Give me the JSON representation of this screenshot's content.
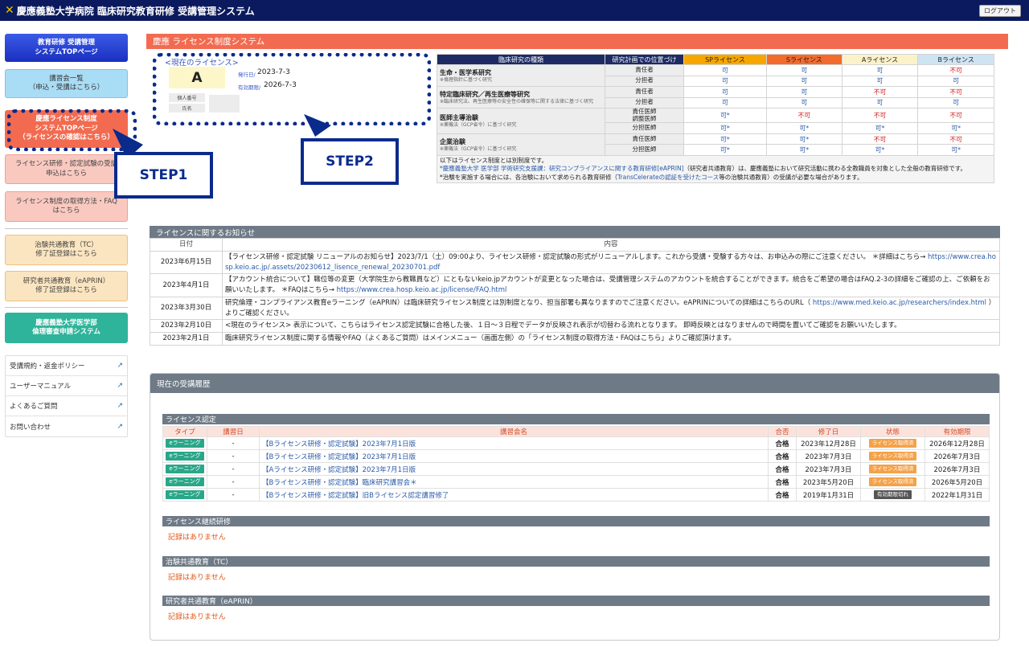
{
  "header": {
    "title": "慶應義塾大学病院 臨床研究教育研修 受講管理システム",
    "logout": "ログアウト"
  },
  "colors": {
    "header": "#0b1a5e",
    "accent": "#f26b50",
    "callout": "#0a2a8c"
  },
  "sidebar": {
    "items": [
      {
        "label": "教育研修 受講管理\nシステムTOPページ"
      },
      {
        "label": "講習会一覧\n（申込・受講はこちら）"
      },
      {
        "label": "慶應ライセンス制度\nシステムTOPページ\n（ライセンスの確認はこちら）"
      },
      {
        "label": "ライセンス研修・認定試験の受講\n申込はこちら"
      },
      {
        "label": "ライセンス制度の取得方法・FAQ\nはこちら"
      },
      {
        "label": "治験共通教育（TC）\n修了証登録はこちら"
      },
      {
        "label": "研究者共通教育（eAPRIN）\n修了証登録はこちら"
      },
      {
        "label": "慶應義塾大学医学部\n倫理審査申請システム"
      }
    ],
    "links": [
      {
        "label": "受講規約・返金ポリシー"
      },
      {
        "label": "ユーザーマニュアル"
      },
      {
        "label": "よくあるご質問"
      },
      {
        "label": "お問い合わせ"
      }
    ]
  },
  "callouts": {
    "step1": "STEP1",
    "step2": "STEP2"
  },
  "license_system": {
    "title": "慶應 ライセンス制度システム",
    "current_label": "<現在のライセンス>",
    "grade": "A",
    "issued_label": "発行日/",
    "issued": "2023-7-3",
    "expiry_label": "有効期限/",
    "expiry": "2026-7-3",
    "personal_no_label": "個人番号",
    "name_label": "氏名",
    "table": {
      "headers": [
        "臨床研究の種類",
        "研究計画での位置づけ",
        "SPライセンス",
        "Sライセンス",
        "Aライセンス",
        "Bライセンス"
      ],
      "groups": [
        {
          "name": "生命・医学系研究",
          "note": "※倫理指針に基づく研究",
          "rows": [
            {
              "role": "責任者",
              "v": [
                "可",
                "可",
                "可",
                "不可"
              ]
            },
            {
              "role": "分担者",
              "v": [
                "可",
                "可",
                "可",
                "可"
              ]
            }
          ]
        },
        {
          "name": "特定臨床研究／再生医療等研究",
          "note": "※臨床研究法、再生医療等の安全性の確保等に関する法律に基づく研究",
          "rows": [
            {
              "role": "責任者",
              "v": [
                "可",
                "可",
                "不可",
                "不可"
              ]
            },
            {
              "role": "分担者",
              "v": [
                "可",
                "可",
                "可",
                "可"
              ]
            }
          ]
        },
        {
          "name": "医師主導治験",
          "note": "※薬機法（GCP省令）に基づく研究",
          "rows": [
            {
              "role": "責任医師\n調整医師",
              "v": [
                "可*",
                "不可",
                "不可",
                "不可"
              ]
            },
            {
              "role": "分担医師",
              "v": [
                "可*",
                "可*",
                "可*",
                "可*"
              ]
            }
          ]
        },
        {
          "name": "企業治験",
          "note": "※薬機法（GCP省令）に基づく研究",
          "rows": [
            {
              "role": "責任医師",
              "v": [
                "可*",
                "可*",
                "不可",
                "不可"
              ]
            },
            {
              "role": "分担医師",
              "v": [
                "可*",
                "可*",
                "可*",
                "可*"
              ]
            }
          ]
        }
      ],
      "notes": {
        "line1": "以下はライセンス制度とは別制度です。",
        "line2a": "*慶應義塾大学 医学部 学術研究支援課：研究コンプライアンスに関する教育研修[eAPRIN]",
        "line2b": "（研究者共通教育）は、慶應義塾において研究活動に携わる全教職員を対象とした全般の教育研修です。",
        "line3a": "*治験を実施する場合には、各治験において求められる教育研修（",
        "line3b": "TransCelerateの認証を受けたコース",
        "line3c": "等の治験共通教育）の受講が必要な場合があります。"
      }
    }
  },
  "news": {
    "title": "ライセンスに関するお知らせ",
    "col_date": "日付",
    "col_content": "内容",
    "rows": [
      {
        "date": "2023年6月15日",
        "text": "【ライセンス研修・認定試験 リニューアルのお知らせ】2023/7/1（土）09:00より、ライセンス研修・認定試験の形式がリニューアルします。これから受講・受験する方々は、お申込みの際にご注意ください。 ＊詳細はこちら→ ",
        "link": "https://www.crea.hosp.keio.ac.jp/.assets/20230612_lisence_renewal_20230701.pdf",
        "after": ""
      },
      {
        "date": "2023年4月1日",
        "text": "【アカウント統合について】職位等の変更（大学院生から教職員など）にともないkeio.jpアカウントが変更となった場合は、受講管理システムのアカウントを統合することができます。統合をご希望の場合はFAQ.2-3の詳細をご確認の上、ご依頼をお願いいたします。 ＊FAQはこちら→ ",
        "link": "https://www.crea.hosp.keio.ac.jp/license/FAQ.html",
        "after": ""
      },
      {
        "date": "2023年3月30日",
        "text": "研究倫理・コンプライアンス教育eラーニング（eAPRIN）は臨床研究ライセンス制度とは別制度となり、担当部署も異なりますのでご注意ください。eAPRINについての詳細はこちらのURL（ ",
        "link": "https://www.med.keio.ac.jp/researchers/index.html",
        "after": " ）よりご確認ください。"
      },
      {
        "date": "2023年2月10日",
        "text": "<現在のライセンス> 表示について、こちらはライセンス認定試験に合格した後、１日～３日程でデータが反映され表示が切替わる流れとなります。 即時反映とはなりませんので時間を置いてご確認をお願いいたします。",
        "link": "",
        "after": ""
      },
      {
        "date": "2023年2月1日",
        "text": "臨床研究ライセンス制度に関する情報やFAQ（よくあるご質問）はメインメニュー（画面左側）の「ライセンス制度の取得方法・FAQはこちら」よりご確認頂けます。",
        "link": "",
        "after": ""
      }
    ]
  },
  "history": {
    "title": "現在の受講履歴",
    "license_cert": {
      "title": "ライセンス認定",
      "headers": [
        "タイプ",
        "講習日",
        "講習会名",
        "合否",
        "修了日",
        "状態",
        "有効期限"
      ],
      "rows": [
        {
          "type": "eラーニング",
          "date": "-",
          "name": "【Bライセンス研修・認定試験】2023年7月1日版",
          "result": "合格",
          "done": "2023年12月28日",
          "status": "ライセンス取得済",
          "expiry": "2026年12月28日"
        },
        {
          "type": "eラーニング",
          "date": "-",
          "name": "【Bライセンス研修・認定試験】2023年7月1日版",
          "result": "合格",
          "done": "2023年7月3日",
          "status": "ライセンス取得済",
          "expiry": "2026年7月3日"
        },
        {
          "type": "eラーニング",
          "date": "-",
          "name": "【Aライセンス研修・認定試験】2023年7月1日版",
          "result": "合格",
          "done": "2023年7月3日",
          "status": "ライセンス取得済",
          "expiry": "2026年7月3日"
        },
        {
          "type": "eラーニング",
          "date": "-",
          "name": "【Bライセンス研修・認定試験】臨床研究講習会＊",
          "result": "合格",
          "done": "2023年5月20日",
          "status": "ライセンス取得済",
          "expiry": "2026年5月20日"
        },
        {
          "type": "eラーニング",
          "date": "-",
          "name": "【Bライセンス研修・認定試験】旧Bライセンス認定講習修了",
          "result": "合格",
          "done": "2019年1月31日",
          "status": "有効期限切れ",
          "expiry": "2022年1月31日"
        }
      ]
    },
    "continuing": {
      "title": "ライセンス継続研修",
      "empty": "記録はありません"
    },
    "tc": {
      "title": "治験共通教育（TC）",
      "empty": "記録はありません"
    },
    "eaprin": {
      "title": "研究者共通教育（eAPRIN）",
      "empty": "記録はありません"
    }
  }
}
